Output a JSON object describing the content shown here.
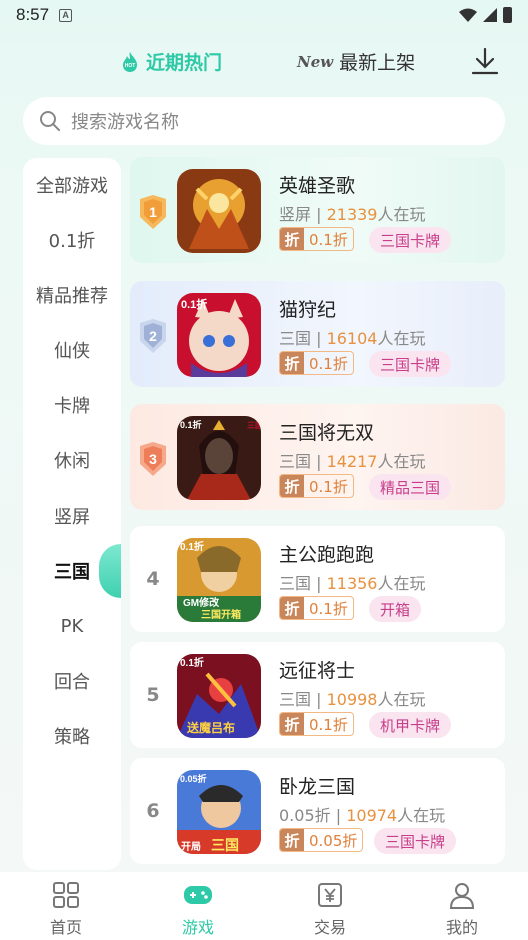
{
  "status_bar": {
    "time": "8:57",
    "notification_letter": "A"
  },
  "top_tabs": {
    "hot": "近期热门",
    "new_badge": "New",
    "new": "最新上架"
  },
  "search": {
    "placeholder": "搜索游戏名称"
  },
  "sidebar": {
    "items": [
      {
        "label": "全部游戏"
      },
      {
        "label": "0.1折"
      },
      {
        "label": "精品推荐"
      },
      {
        "label": "仙侠"
      },
      {
        "label": "卡牌"
      },
      {
        "label": "休闲"
      },
      {
        "label": "竖屏"
      },
      {
        "label": "三国"
      },
      {
        "label": "PK"
      },
      {
        "label": "回合"
      },
      {
        "label": "策略"
      }
    ],
    "active_index": 7
  },
  "discount_char": "折",
  "games": [
    {
      "rank": "1",
      "name": "英雄圣歌",
      "category": "竖屏",
      "players": "21339",
      "players_suffix": "人在玩",
      "discount": "0.1折",
      "tag": "三国卡牌"
    },
    {
      "rank": "2",
      "name": "猫狩纪",
      "category": "三国",
      "players": "16104",
      "players_suffix": "人在玩",
      "discount": "0.1折",
      "tag": "三国卡牌"
    },
    {
      "rank": "3",
      "name": "三国将无双",
      "category": "三国",
      "players": "14217",
      "players_suffix": "人在玩",
      "discount": "0.1折",
      "tag": "精品三国"
    },
    {
      "rank": "4",
      "name": "主公跑跑跑",
      "category": "三国",
      "players": "11356",
      "players_suffix": "人在玩",
      "discount": "0.1折",
      "tag": "开箱"
    },
    {
      "rank": "5",
      "name": "远征将士",
      "category": "三国",
      "players": "10998",
      "players_suffix": "人在玩",
      "discount": "0.1折",
      "tag": "机甲卡牌"
    },
    {
      "rank": "6",
      "name": "卧龙三国",
      "category": "0.05折",
      "players": "10974",
      "players_suffix": "人在玩",
      "discount": "0.05折",
      "tag": "三国卡牌"
    }
  ],
  "icon_texts": {
    "g2": "0.1折",
    "g3_tl": "0.1折",
    "g3_tr": "三国",
    "g4_top": "0.1折",
    "g4_bottom1": "GM修改",
    "g4_bottom2": "三国开箱",
    "g5_top": "0.1折",
    "g5_bottom": "送魔吕布",
    "g6_top": "0.05折",
    "g6_bottom1": "开局",
    "g6_bottom2": "三国"
  },
  "bottom_nav": [
    {
      "label": "首页",
      "icon": "grid-icon"
    },
    {
      "label": "游戏",
      "icon": "gamepad-icon"
    },
    {
      "label": "交易",
      "icon": "yen-trade-icon"
    },
    {
      "label": "我的",
      "icon": "person-icon"
    }
  ],
  "colors": {
    "accent": "#2ec9a6",
    "players": "#e8913e",
    "tag_bg": "#f9e4ef",
    "tag_text": "#c83e8a"
  }
}
